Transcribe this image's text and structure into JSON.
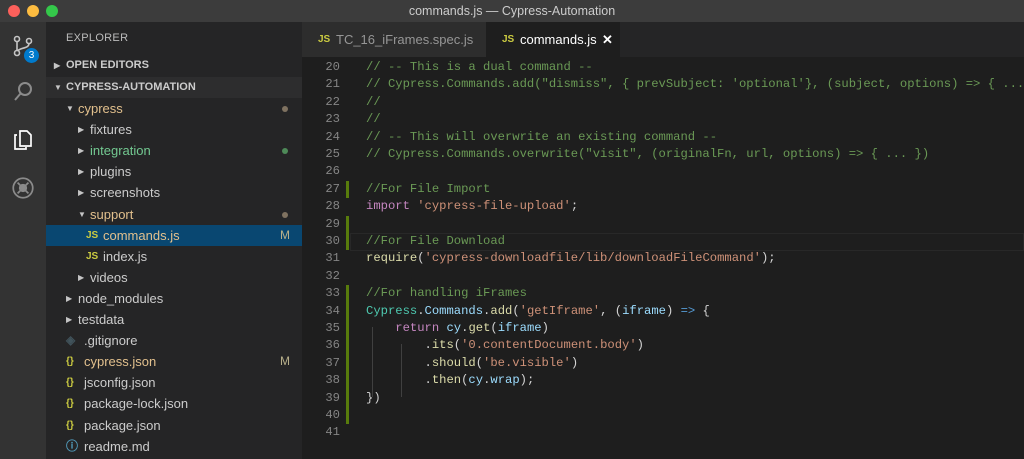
{
  "window": {
    "title": "commands.js — Cypress-Automation"
  },
  "activity_bar": {
    "scm_badge": "3",
    "icons": [
      "source-control-icon",
      "search-icon",
      "explorer-files-icon",
      "debug-icon"
    ]
  },
  "sidebar": {
    "title": "EXPLORER",
    "open_editors": "OPEN EDITORS",
    "project": "CYPRESS-AUTOMATION",
    "rows": [
      {
        "label": "cypress",
        "twisty": "▼",
        "depth": 1,
        "type": "folder",
        "color": "#e2c08d",
        "dot": "#7f7260"
      },
      {
        "label": "fixtures",
        "twisty": "▶",
        "depth": 2,
        "type": "folder",
        "color": "#cccccc"
      },
      {
        "label": "integration",
        "twisty": "▶",
        "depth": 2,
        "type": "folder",
        "color": "#73c991",
        "dot": "#4e8a58"
      },
      {
        "label": "plugins",
        "twisty": "▶",
        "depth": 2,
        "type": "folder",
        "color": "#cccccc"
      },
      {
        "label": "screenshots",
        "twisty": "▶",
        "depth": 2,
        "type": "folder",
        "color": "#cccccc"
      },
      {
        "label": "support",
        "twisty": "▼",
        "depth": 2,
        "type": "folder",
        "color": "#e2c08d",
        "dot": "#7f7260"
      },
      {
        "label": "commands.js",
        "icon": "JS",
        "depth": 3,
        "type": "js",
        "color": "#e2c08d",
        "mod": "M",
        "selected": true
      },
      {
        "label": "index.js",
        "icon": "JS",
        "depth": 3,
        "type": "js",
        "color": "#cccccc"
      },
      {
        "label": "videos",
        "twisty": "▶",
        "depth": 2,
        "type": "folder",
        "color": "#cccccc"
      },
      {
        "label": "node_modules",
        "twisty": "▶",
        "depth": 1,
        "type": "folder",
        "color": "#cccccc"
      },
      {
        "label": "testdata",
        "twisty": "▶",
        "depth": 1,
        "type": "folder",
        "color": "#cccccc"
      },
      {
        "label": ".gitignore",
        "icon": "◈",
        "depth": 1,
        "type": "git",
        "color": "#cccccc"
      },
      {
        "label": "cypress.json",
        "icon": "{}",
        "depth": 1,
        "type": "json",
        "color": "#e2c08d",
        "mod": "M"
      },
      {
        "label": "jsconfig.json",
        "icon": "{}",
        "depth": 1,
        "type": "json",
        "color": "#cccccc"
      },
      {
        "label": "package-lock.json",
        "icon": "{}",
        "depth": 1,
        "type": "json",
        "color": "#cccccc"
      },
      {
        "label": "package.json",
        "icon": "{}",
        "depth": 1,
        "type": "json",
        "color": "#cccccc"
      },
      {
        "label": "readme.md",
        "icon": "ⓘ",
        "depth": 1,
        "type": "info",
        "color": "#cccccc"
      }
    ]
  },
  "tabs": [
    {
      "icon": "JS",
      "label": "TC_16_iFrames.spec.js",
      "active": false
    },
    {
      "icon": "JS",
      "label": "commands.js",
      "active": true,
      "close": "✕"
    }
  ],
  "editor": {
    "lines": [
      {
        "n": "20",
        "tokens": [
          [
            "c",
            "// -- This is a dual command --"
          ]
        ]
      },
      {
        "n": "21",
        "tokens": [
          [
            "c",
            "// Cypress.Commands.add(\"dismiss\", { prevSubject: 'optional'}, (subject, options) => { ... })"
          ]
        ]
      },
      {
        "n": "22",
        "tokens": [
          [
            "c",
            "//"
          ]
        ]
      },
      {
        "n": "23",
        "tokens": [
          [
            "c",
            "//"
          ]
        ]
      },
      {
        "n": "24",
        "tokens": [
          [
            "c",
            "// -- This will overwrite an existing command --"
          ]
        ]
      },
      {
        "n": "25",
        "tokens": [
          [
            "c",
            "// Cypress.Commands.overwrite(\"visit\", (originalFn, url, options) => { ... })"
          ]
        ]
      },
      {
        "n": "26",
        "tokens": []
      },
      {
        "n": "27",
        "mark": true,
        "tokens": [
          [
            "c",
            "//For File Import"
          ]
        ]
      },
      {
        "n": "28",
        "tokens": [
          [
            "k",
            "import"
          ],
          [
            "p",
            " "
          ],
          [
            "s",
            "'cypress-file-upload'"
          ],
          [
            "p",
            ";"
          ]
        ]
      },
      {
        "n": "29",
        "mark": true,
        "tokens": []
      },
      {
        "n": "30",
        "mark": true,
        "current": true,
        "tokens": [
          [
            "c",
            "//For File Download"
          ]
        ]
      },
      {
        "n": "31",
        "tokens": [
          [
            "f",
            "require"
          ],
          [
            "p",
            "("
          ],
          [
            "s",
            "'cypress-downloadfile/lib/downloadFileCommand'"
          ],
          [
            "p",
            ");"
          ]
        ]
      },
      {
        "n": "32",
        "tokens": []
      },
      {
        "n": "33",
        "mark": true,
        "tokens": [
          [
            "c",
            "//For handling iFrames"
          ]
        ]
      },
      {
        "n": "34",
        "mark": true,
        "tokens": [
          [
            "t",
            "Cypress"
          ],
          [
            "p",
            "."
          ],
          [
            "v",
            "Commands"
          ],
          [
            "p",
            "."
          ],
          [
            "f",
            "add"
          ],
          [
            "p",
            "("
          ],
          [
            "s",
            "'getIframe'"
          ],
          [
            "p",
            ", ("
          ],
          [
            "v",
            "iframe"
          ],
          [
            "p",
            ") "
          ],
          [
            "b",
            "=>"
          ],
          [
            "p",
            " {"
          ]
        ]
      },
      {
        "n": "35",
        "mark": true,
        "tokens": [
          [
            "p",
            "    "
          ],
          [
            "k",
            "return"
          ],
          [
            "p",
            " "
          ],
          [
            "v",
            "cy"
          ],
          [
            "p",
            "."
          ],
          [
            "f",
            "get"
          ],
          [
            "p",
            "("
          ],
          [
            "v",
            "iframe"
          ],
          [
            "p",
            ")"
          ]
        ]
      },
      {
        "n": "36",
        "mark": true,
        "tokens": [
          [
            "p",
            "        ."
          ],
          [
            "f",
            "its"
          ],
          [
            "p",
            "("
          ],
          [
            "s",
            "'0.contentDocument.body'"
          ],
          [
            "p",
            ")"
          ]
        ]
      },
      {
        "n": "37",
        "mark": true,
        "tokens": [
          [
            "p",
            "        ."
          ],
          [
            "f",
            "should"
          ],
          [
            "p",
            "("
          ],
          [
            "s",
            "'be.visible'"
          ],
          [
            "p",
            ")"
          ]
        ]
      },
      {
        "n": "38",
        "mark": true,
        "tokens": [
          [
            "p",
            "        ."
          ],
          [
            "f",
            "then"
          ],
          [
            "p",
            "("
          ],
          [
            "v",
            "cy"
          ],
          [
            "p",
            "."
          ],
          [
            "v",
            "wrap"
          ],
          [
            "p",
            ");"
          ]
        ]
      },
      {
        "n": "39",
        "mark": true,
        "tokens": [
          [
            "p",
            "})"
          ]
        ]
      },
      {
        "n": "40",
        "mark": true,
        "tokens": []
      },
      {
        "n": "41",
        "tokens": []
      }
    ]
  }
}
